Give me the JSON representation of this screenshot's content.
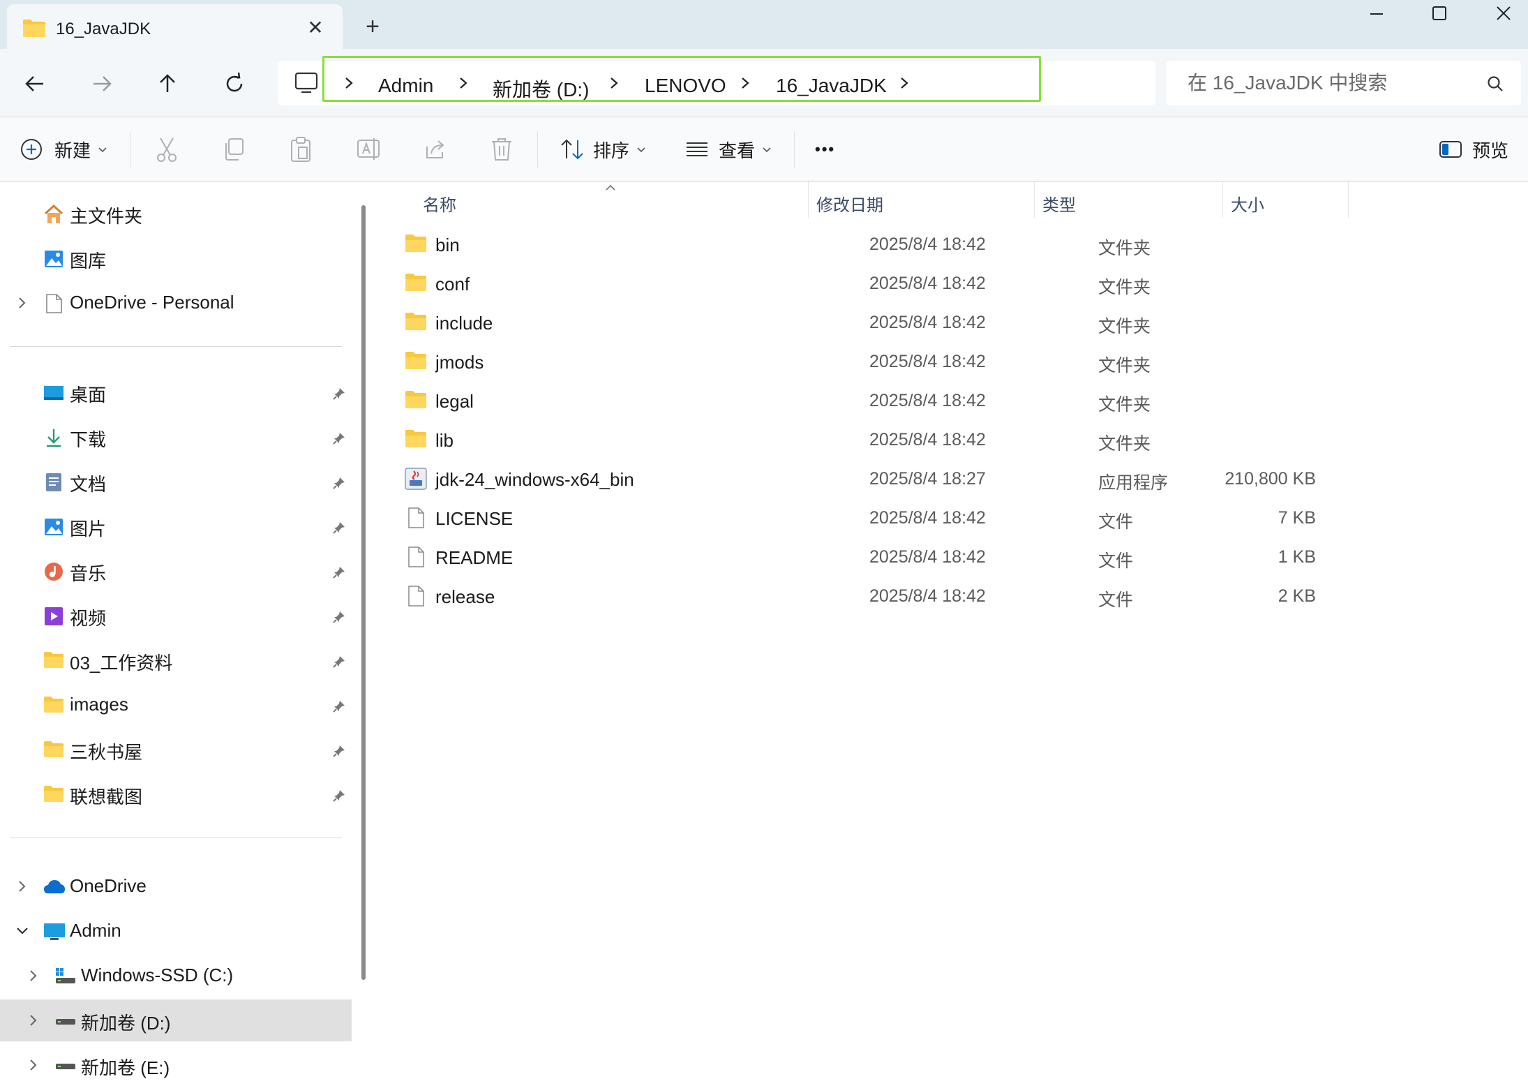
{
  "tab": {
    "title": "16_JavaJDK",
    "close": "✕"
  },
  "newtab": "+",
  "breadcrumb": [
    {
      "label": "Admin"
    },
    {
      "label": "新加卷 (D:)"
    },
    {
      "label": "LENOVO"
    },
    {
      "label": "16_JavaJDK"
    }
  ],
  "search": {
    "placeholder": "在 16_JavaJDK 中搜索"
  },
  "toolbar": {
    "new_label": "新建",
    "sort_label": "排序",
    "view_label": "查看",
    "more_label": "•••",
    "preview_label": "预览"
  },
  "sidebar": {
    "top": [
      {
        "label": "主文件夹",
        "icon": "home-icon"
      },
      {
        "label": "图库",
        "icon": "gallery-icon"
      },
      {
        "label": "OneDrive - Personal",
        "icon": "document-icon"
      }
    ],
    "pinned": [
      {
        "label": "桌面",
        "icon": "desktop-icon"
      },
      {
        "label": "下载",
        "icon": "download-icon"
      },
      {
        "label": "文档",
        "icon": "documents-icon"
      },
      {
        "label": "图片",
        "icon": "pictures-icon"
      },
      {
        "label": "音乐",
        "icon": "music-icon"
      },
      {
        "label": "视频",
        "icon": "video-icon"
      },
      {
        "label": "03_工作资料",
        "icon": "folder-icon"
      },
      {
        "label": "images",
        "icon": "folder-icon"
      },
      {
        "label": "三秋书屋",
        "icon": "folder-icon"
      },
      {
        "label": "联想截图",
        "icon": "folder-icon"
      }
    ],
    "bottom": [
      {
        "label": "OneDrive",
        "icon": "cloud-icon"
      },
      {
        "label": "Admin",
        "icon": "pc-icon"
      },
      {
        "label": "Windows-SSD (C:)",
        "icon": "drive-icon"
      },
      {
        "label": "新加卷 (D:)",
        "icon": "drive-icon",
        "selected": true
      },
      {
        "label": "新加卷 (E:)",
        "icon": "drive-icon"
      }
    ]
  },
  "columns": {
    "name": "名称",
    "date": "修改日期",
    "type": "类型",
    "size": "大小"
  },
  "files": [
    {
      "name": "bin",
      "date": "2025/8/4 18:42",
      "type": "文件夹",
      "size": "",
      "icon": "folder-icon"
    },
    {
      "name": "conf",
      "date": "2025/8/4 18:42",
      "type": "文件夹",
      "size": "",
      "icon": "folder-icon"
    },
    {
      "name": "include",
      "date": "2025/8/4 18:42",
      "type": "文件夹",
      "size": "",
      "icon": "folder-icon"
    },
    {
      "name": "jmods",
      "date": "2025/8/4 18:42",
      "type": "文件夹",
      "size": "",
      "icon": "folder-icon"
    },
    {
      "name": "legal",
      "date": "2025/8/4 18:42",
      "type": "文件夹",
      "size": "",
      "icon": "folder-icon"
    },
    {
      "name": "lib",
      "date": "2025/8/4 18:42",
      "type": "文件夹",
      "size": "",
      "icon": "folder-icon"
    },
    {
      "name": "jdk-24_windows-x64_bin",
      "date": "2025/8/4 18:27",
      "type": "应用程序",
      "size": "210,800 KB",
      "icon": "installer-icon"
    },
    {
      "name": "LICENSE",
      "date": "2025/8/4 18:42",
      "type": "文件",
      "size": "7 KB",
      "icon": "file-icon"
    },
    {
      "name": "README",
      "date": "2025/8/4 18:42",
      "type": "文件",
      "size": "1 KB",
      "icon": "file-icon"
    },
    {
      "name": "release",
      "date": "2025/8/4 18:42",
      "type": "文件",
      "size": "2 KB",
      "icon": "file-icon"
    }
  ],
  "colors": {
    "highlight": "#86e03a",
    "selected_bg": "#e0e0e0",
    "folder": "#f8c93e",
    "accent": "#0067c0"
  }
}
